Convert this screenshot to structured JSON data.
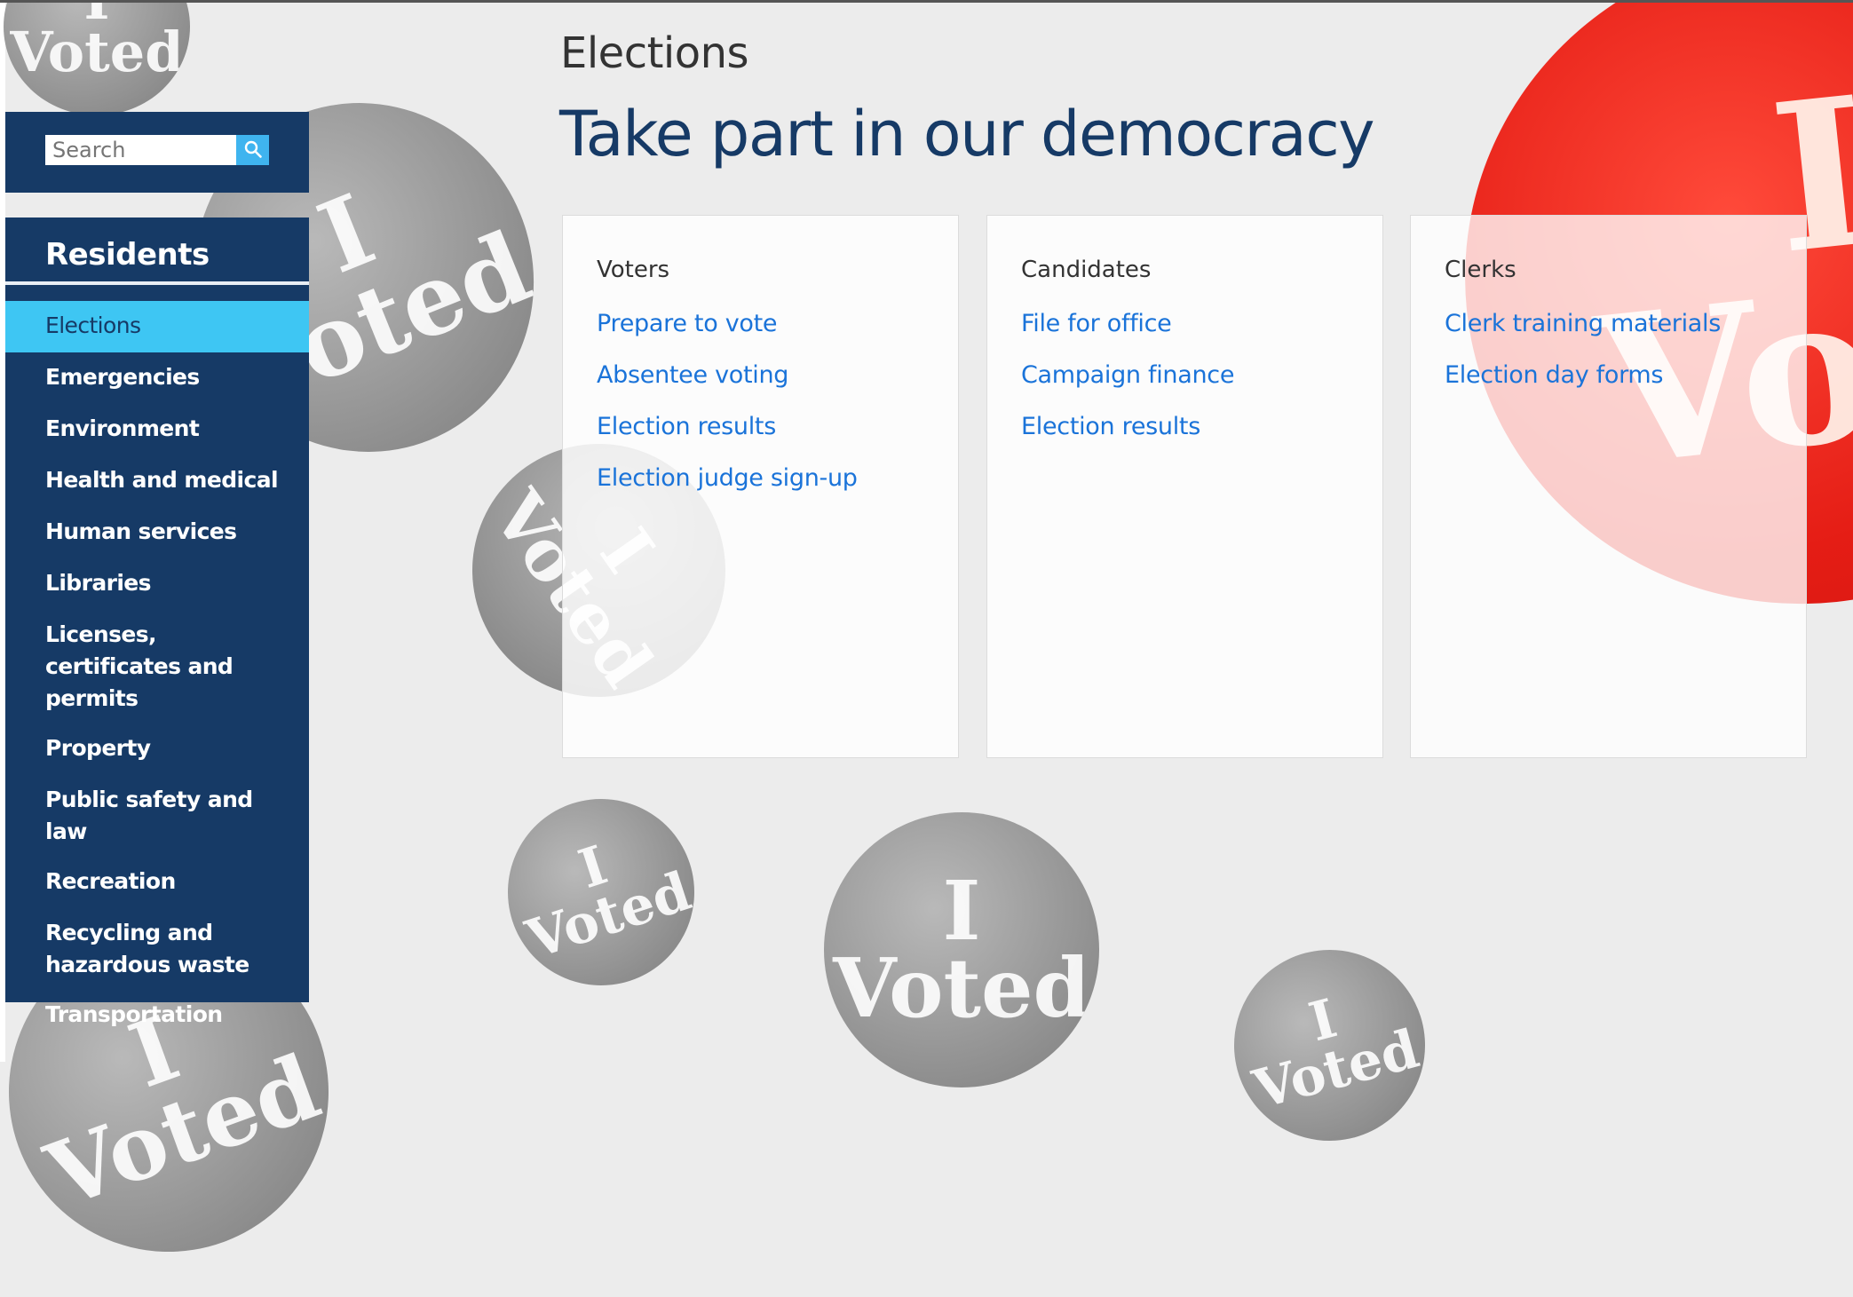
{
  "search": {
    "placeholder": "Search",
    "button_icon": "search-icon"
  },
  "sidebar": {
    "heading": "Residents",
    "items": [
      {
        "label": "Elections",
        "active": true
      },
      {
        "label": "Emergencies"
      },
      {
        "label": "Environment"
      },
      {
        "label": "Health and medical"
      },
      {
        "label": "Human services"
      },
      {
        "label": "Libraries"
      },
      {
        "label": "Licenses, certificates and permits"
      },
      {
        "label": "Property"
      },
      {
        "label": "Public safety and law"
      },
      {
        "label": "Recreation"
      },
      {
        "label": "Recycling and hazardous waste"
      },
      {
        "label": "Transportation"
      }
    ]
  },
  "main": {
    "section": "Elections",
    "title": "Take part in our democracy",
    "cards": [
      {
        "title": "Voters",
        "links": [
          "Prepare to vote",
          "Absentee voting",
          "Election results",
          "Election judge sign-up"
        ]
      },
      {
        "title": "Candidates",
        "links": [
          "File for office",
          "Campaign finance",
          "Election results"
        ]
      },
      {
        "title": "Clerks",
        "links": [
          "Clerk training materials",
          "Election day forms"
        ]
      }
    ]
  },
  "background": {
    "sticker_line1": "I",
    "sticker_line2": "Voted"
  },
  "colors": {
    "nav_bg": "#163a66",
    "nav_active": "#3ec6f3",
    "link": "#1a73d9",
    "search_button": "#3fb4ef"
  }
}
